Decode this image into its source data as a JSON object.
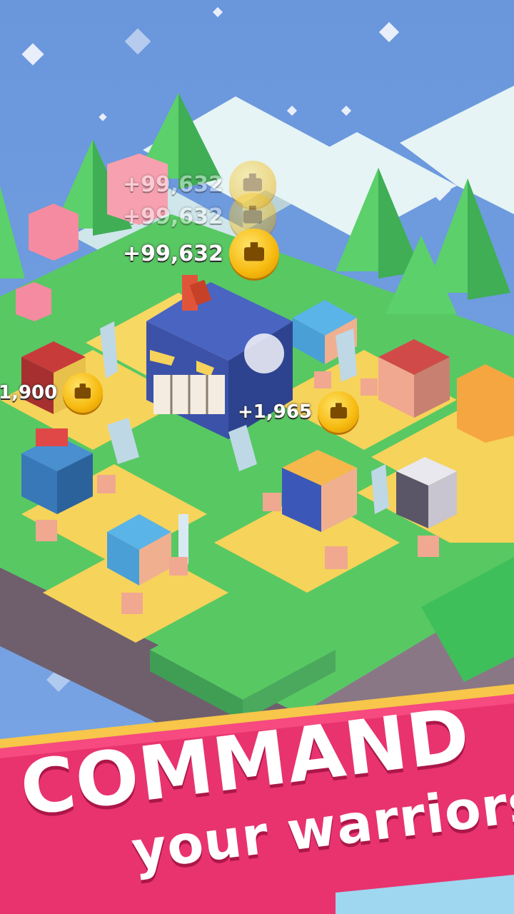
{
  "rewards": [
    {
      "amount": "+99,632",
      "faded": true
    },
    {
      "amount": "+99,632",
      "faded": true
    },
    {
      "amount": "+99,632",
      "faded": false
    },
    {
      "amount": "1,900",
      "faded": false
    },
    {
      "amount": "+1,965",
      "faded": false
    }
  ],
  "banner": {
    "line1": "COMMAND",
    "line2": "your warriors!",
    "color": "#e8336f",
    "stripe_color": "#f7c64a"
  },
  "colors": {
    "sky": "#6b97dd",
    "grass": "#5fcf6a",
    "sand": "#f6d35a",
    "snow": "#dff0f2",
    "cliff": "#7d6b78",
    "tree": "#3fbf5a",
    "boss": "#3c52a8"
  }
}
